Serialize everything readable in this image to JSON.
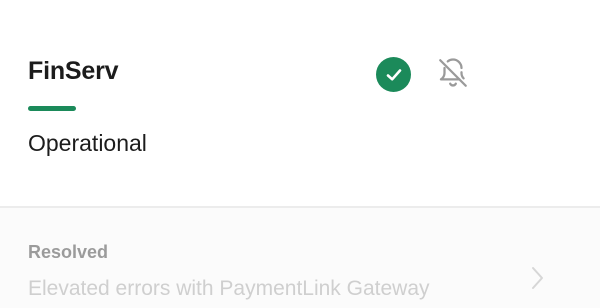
{
  "service": {
    "name": "FinServ",
    "status": "Operational"
  },
  "colors": {
    "accent_green": "#1b8a5a",
    "bell_gray": "#9a9a9a"
  },
  "icons": {
    "status": "check-circle-icon",
    "notifications": "bell-off-icon",
    "row_arrow": "chevron-right-icon"
  },
  "incident": {
    "state": "Resolved",
    "title": "Elevated errors with PaymentLink Gateway"
  }
}
